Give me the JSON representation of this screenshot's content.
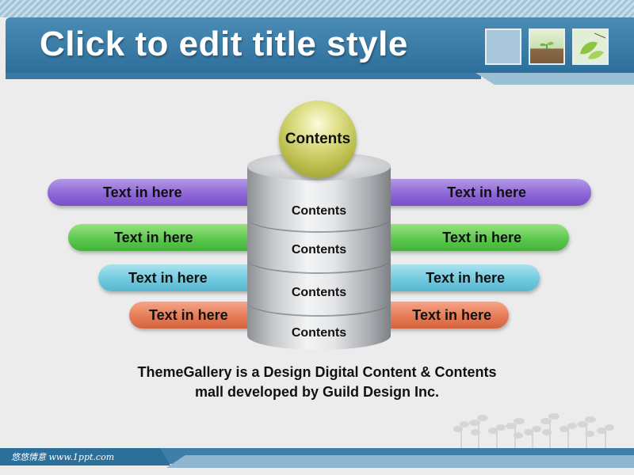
{
  "title": "Click to edit title style",
  "diagram": {
    "ball_label": "Contents",
    "layers": [
      "Contents",
      "Contents",
      "Contents",
      "Contents"
    ],
    "left_bars": [
      {
        "label": "Text in here",
        "color": "#8b62d6"
      },
      {
        "label": "Text in here",
        "color": "#58c64c"
      },
      {
        "label": "Text in here",
        "color": "#6ec8de"
      },
      {
        "label": "Text in here",
        "color": "#e47852"
      }
    ],
    "right_bars": [
      {
        "label": "Text in here",
        "color": "#8b62d6"
      },
      {
        "label": "Text in here",
        "color": "#58c64c"
      },
      {
        "label": "Text in here",
        "color": "#6ec8de"
      },
      {
        "label": "Text in here",
        "color": "#e47852"
      }
    ]
  },
  "caption": {
    "line1": "ThemeGallery is a Design Digital Content & Contents",
    "line2": "mall developed by Guild Design Inc."
  },
  "footer": {
    "text": "悠悠情意  www.1ppt.com"
  },
  "colors": {
    "title_band": "#2d6f9b",
    "background": "#ececec"
  }
}
